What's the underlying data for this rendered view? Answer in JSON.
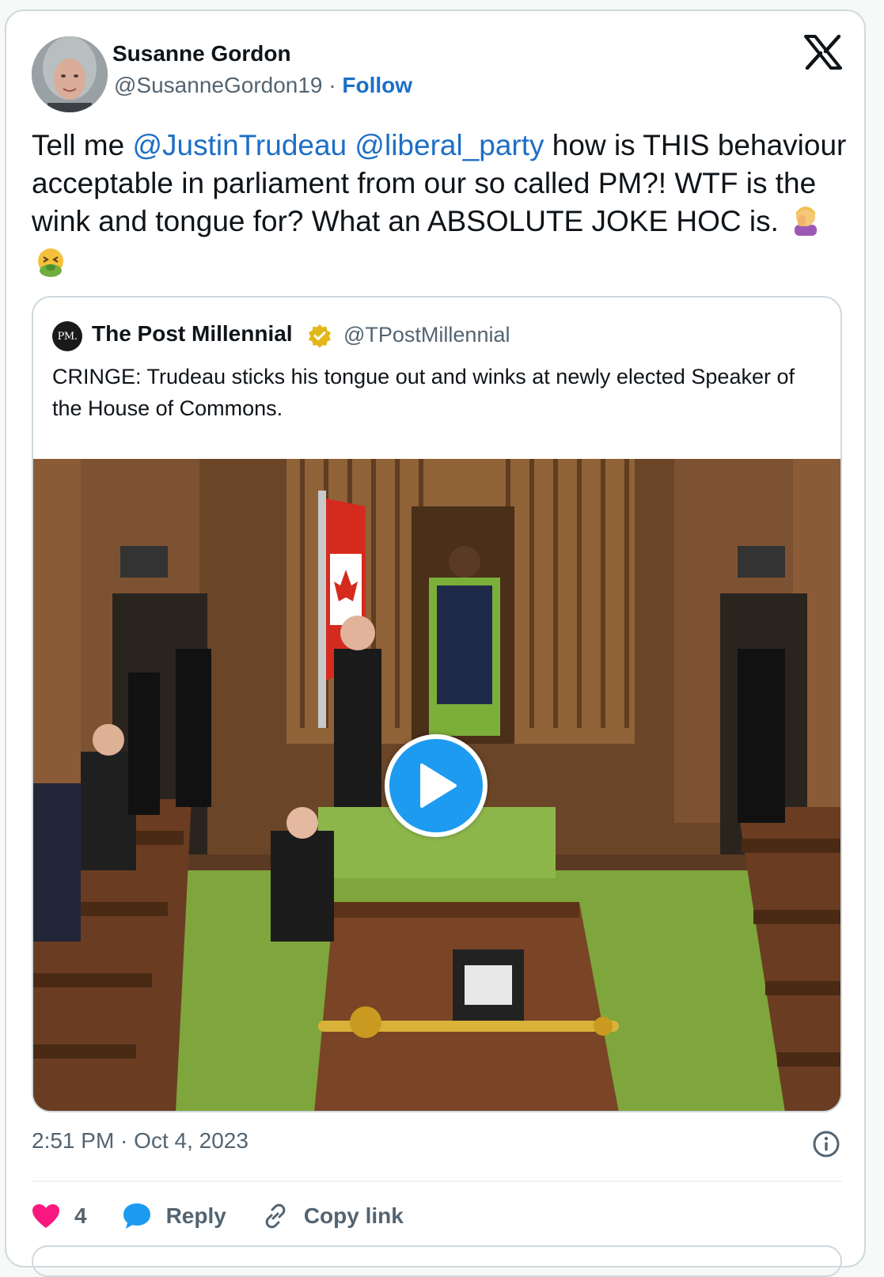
{
  "author": {
    "name": "Susanne Gordon",
    "handle": "@SusanneGordon19",
    "separator": "·",
    "follow_label": "Follow"
  },
  "tweet": {
    "text_part1": "Tell me ",
    "mention1": "@JustinTrudeau",
    "text_space": " ",
    "mention2": "@liberal_party",
    "text_part2": " how is THIS behaviour acceptable in parliament from our so called PM?! WTF is the wink and tongue for? What an ABSOLUTE JOKE HOC is.",
    "emojis": [
      "face-palm-emoji",
      "vomiting-face-emoji"
    ]
  },
  "quote": {
    "avatar_text": "PM.",
    "name": "The Post Millennial",
    "handle": "@TPostMillennial",
    "text": "CRINGE: Trudeau sticks his tongue out and winks at newly elected Speaker of the House of Commons.",
    "media_description_icon": "video-play-icon"
  },
  "meta": {
    "timestamp": "2:51 PM · Oct 4, 2023"
  },
  "actions": {
    "like_count": "4",
    "reply_label": "Reply",
    "copy_label": "Copy link"
  },
  "colors": {
    "link": "#1d6fc7",
    "like": "#f91880",
    "reply": "#1d9bf0",
    "muted": "#536471",
    "border": "#cfd9de"
  }
}
